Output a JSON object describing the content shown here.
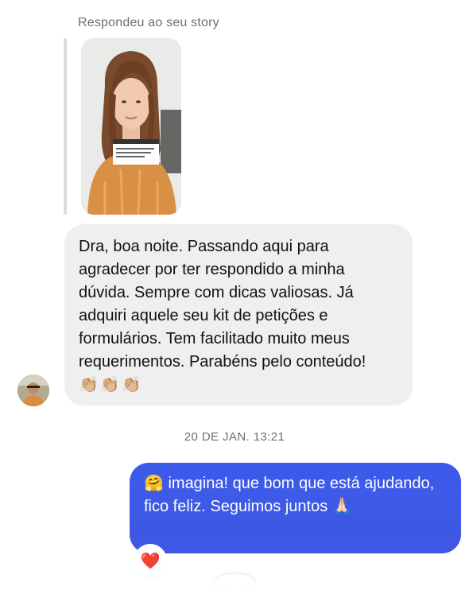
{
  "story_reply": {
    "caption": "Respondeu ao seu story",
    "thumbnail": "story-video-woman-speaking"
  },
  "incoming": {
    "text": "Dra, boa noite. Passando aqui para agradecer por ter respondido a minha dúvida. Sempre com dicas valiosas. Já adquiri aquele seu kit de petições e formulários. Tem facilitado muito meus requerimentos. Parabéns pelo conteúdo!",
    "emoji": "👏🏼👏🏼👏🏼",
    "sender_avatar": "user-avatar"
  },
  "timestamp": "20 DE JAN. 13:21",
  "outgoing": {
    "text": "🤗 imagina! que bom que está ajudando, fico feliz. Seguimos juntos 🙏🏻",
    "reaction": "❤️"
  },
  "colors": {
    "incoming_bubble": "#efefef",
    "outgoing_bubble": "#3d5ae6",
    "muted_text": "#6e6e6e"
  }
}
